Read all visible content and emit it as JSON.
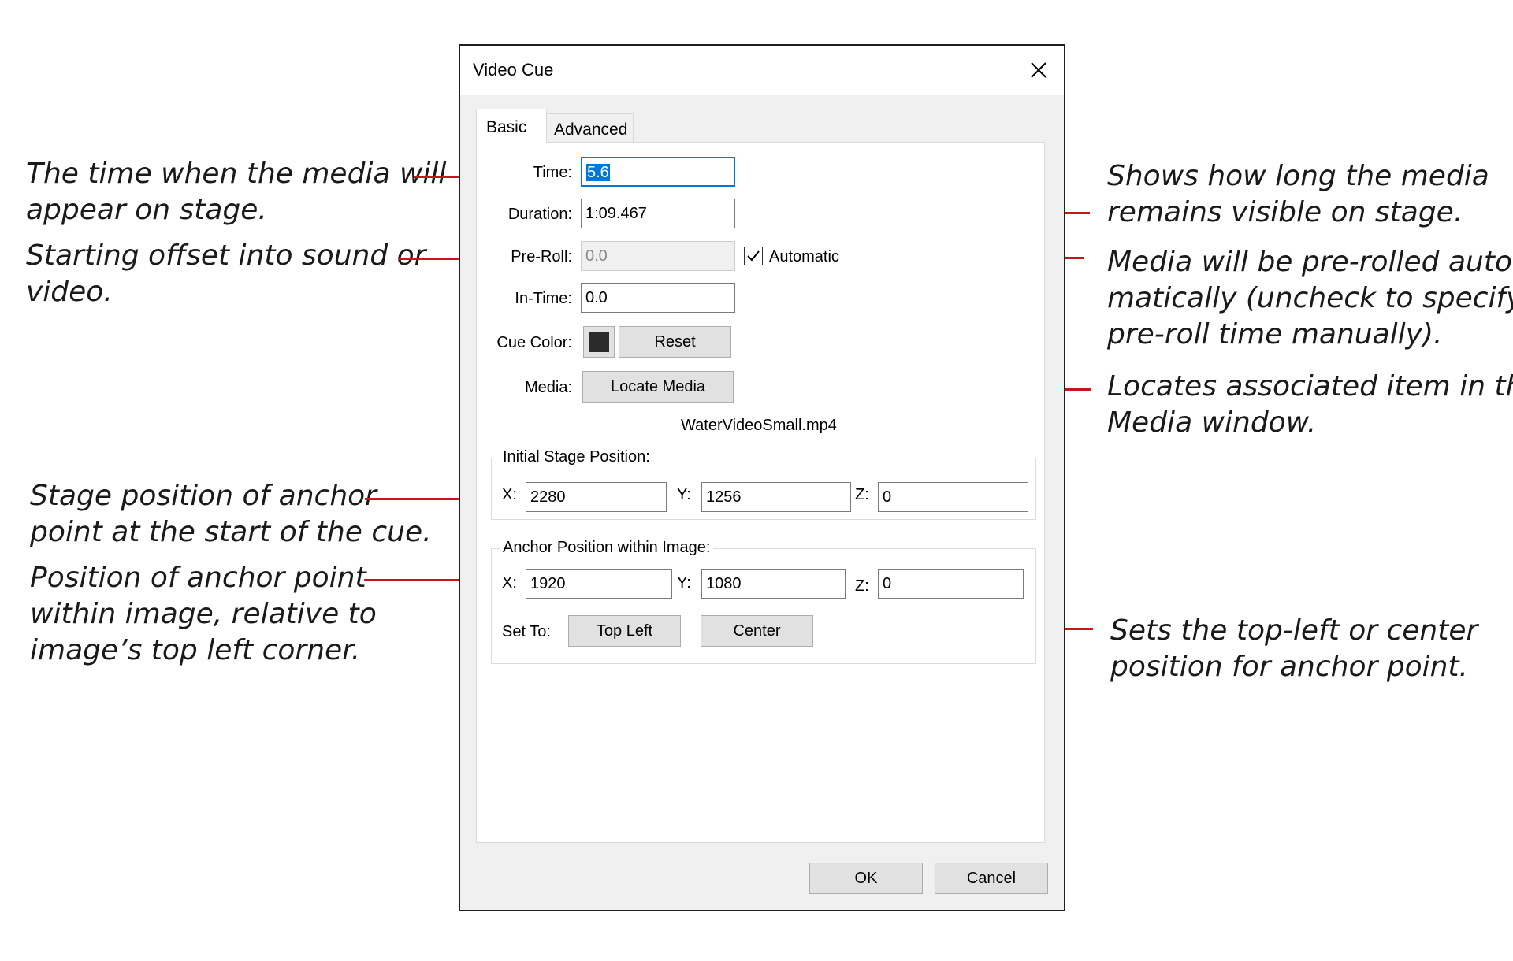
{
  "annotations": {
    "time": [
      "The time when the media will",
      "appear on stage."
    ],
    "offset": [
      "Starting offset into sound or",
      "video."
    ],
    "stage_pos": [
      "Stage position of anchor",
      "point at the start of the cue."
    ],
    "anchor_pos": [
      "Position of anchor point",
      "within image, relative to",
      "image’s top left corner."
    ],
    "duration": [
      "Shows how long the media",
      "remains visible on stage."
    ],
    "automatic": [
      "Media will be pre-rolled auto-",
      "matically (uncheck to specify",
      "pre-roll time manually)."
    ],
    "locate": [
      "Locates associated item in the",
      "Media window."
    ],
    "set_to": [
      "Sets the top-left or center",
      "position for anchor point."
    ]
  },
  "dialog": {
    "title": "Video Cue",
    "tabs": [
      "Basic",
      "Advanced"
    ],
    "fields": {
      "time_label": "Time:",
      "time_value": "5.6",
      "duration_label": "Duration:",
      "duration_value": "1:09.467",
      "preroll_label": "Pre-Roll:",
      "preroll_value": "0.0",
      "automatic_label": "Automatic",
      "automatic_checked": true,
      "intime_label": "In-Time:",
      "intime_value": "0.0",
      "cuecolor_label": "Cue Color:",
      "cue_color": "#2b2b2b",
      "reset_label": "Reset",
      "media_label": "Media:",
      "locate_media_label": "Locate Media",
      "media_filename": "WaterVideoSmall.mp4"
    },
    "stage_position": {
      "title": "Initial Stage Position:",
      "x_label": "X:",
      "x_value": "2280",
      "y_label": "Y:",
      "y_value": "1256",
      "z_label": "Z:",
      "z_value": "0"
    },
    "anchor_position": {
      "title": "Anchor Position within Image:",
      "x_label": "X:",
      "x_value": "1920",
      "y_label": "Y:",
      "y_value": "1080",
      "z_label": "Z:",
      "z_value": "0",
      "set_to_label": "Set To:",
      "top_left_label": "Top Left",
      "center_label": "Center"
    },
    "ok_label": "OK",
    "cancel_label": "Cancel"
  },
  "colors": {
    "callout_line": "#c4161c",
    "focus": "#0078d7"
  }
}
